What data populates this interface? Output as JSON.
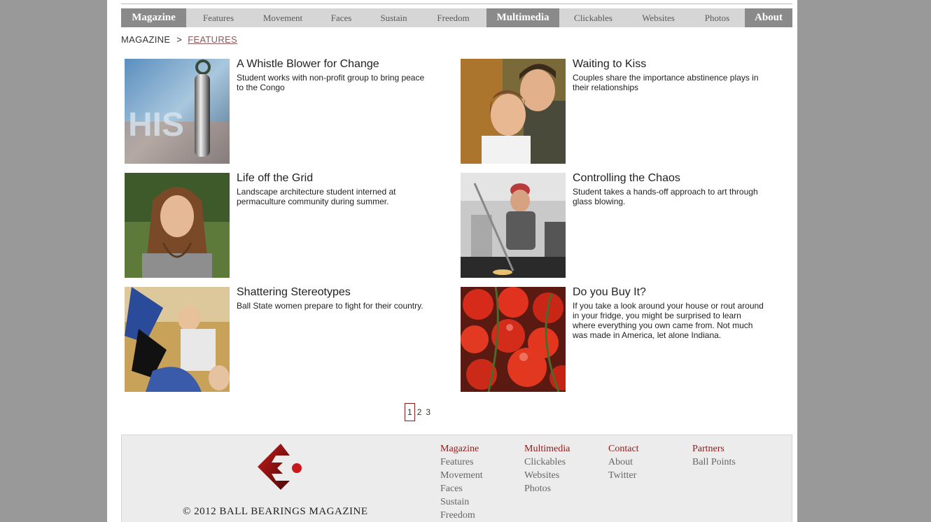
{
  "nav": {
    "items": [
      {
        "label": "Magazine"
      },
      {
        "label": "Features"
      },
      {
        "label": "Movement"
      },
      {
        "label": "Faces"
      },
      {
        "label": "Sustain"
      },
      {
        "label": "Freedom"
      },
      {
        "label": "Multimedia"
      },
      {
        "label": "Clickables"
      },
      {
        "label": "Websites"
      },
      {
        "label": "Photos"
      },
      {
        "label": "About"
      }
    ]
  },
  "breadcrumb": {
    "root": "MAGAZINE",
    "separator": ">",
    "current": "FEATURES"
  },
  "articles": [
    {
      "title": "A Whistle Blower for Change",
      "description": "Student works with non-profit group to bring peace to the Congo"
    },
    {
      "title": "Waiting to Kiss",
      "description": "Couples share the importance abstinence plays in their relationships"
    },
    {
      "title": "Life off the Grid",
      "description": "Landscape architecture student interned at permaculture community during summer."
    },
    {
      "title": "Controlling the Chaos",
      "description": "Student takes a hands-off approach to art through glass blowing."
    },
    {
      "title": "Shattering Stereotypes",
      "description": "Ball State women prepare to fight for their country."
    },
    {
      "title": "Do you Buy It?",
      "description": "If you take a look around your house or rout around in your fridge, you might be surprised to learn where everything you own came from. Not much was made in America, let alone Indiana."
    }
  ],
  "pagination": {
    "pages": [
      "1",
      "2",
      "3"
    ],
    "current": "1"
  },
  "footer": {
    "copyright": "© 2012 BALL BEARINGS MAGAZINE",
    "columns": [
      {
        "heading": "Magazine",
        "links": [
          "Features",
          "Movement",
          "Faces",
          "Sustain",
          "Freedom"
        ]
      },
      {
        "heading": "Multimedia",
        "links": [
          "Clickables",
          "Websites",
          "Photos"
        ]
      },
      {
        "heading": "Contact",
        "links": [
          "About",
          "Twitter"
        ]
      },
      {
        "heading": "Partners",
        "links": [
          "Ball Points"
        ]
      }
    ]
  },
  "colors": {
    "background": "#999999",
    "nav_bar": "#d6d6d6",
    "nav_highlight": "#8a8a8a",
    "accent_red": "#8b1a1a",
    "footer_bg": "#ececec"
  }
}
